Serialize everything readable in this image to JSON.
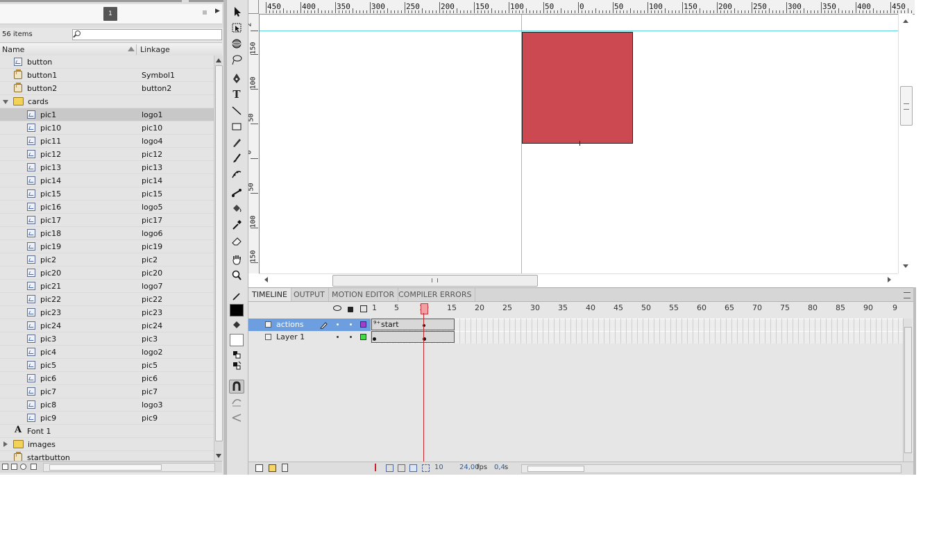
{
  "library": {
    "doc_tab_number": "1",
    "item_count": "56 items",
    "search_placeholder": "",
    "col_name": "Name",
    "col_linkage": "Linkage",
    "items": [
      {
        "name": "button",
        "linkage": "",
        "type": "bitmap",
        "indent": 1
      },
      {
        "name": "button1",
        "linkage": "Symbol1",
        "type": "button",
        "indent": 1
      },
      {
        "name": "button2",
        "linkage": "button2",
        "type": "button",
        "indent": 1
      },
      {
        "name": "cards",
        "linkage": "",
        "type": "folder-open",
        "indent": 0
      },
      {
        "name": "pic1",
        "linkage": "logo1",
        "type": "bitmap",
        "indent": 2,
        "selected": true
      },
      {
        "name": "pic10",
        "linkage": "pic10",
        "type": "bitmap",
        "indent": 2
      },
      {
        "name": "pic11",
        "linkage": "logo4",
        "type": "bitmap",
        "indent": 2
      },
      {
        "name": "pic12",
        "linkage": "pic12",
        "type": "bitmap",
        "indent": 2
      },
      {
        "name": "pic13",
        "linkage": "pic13",
        "type": "bitmap",
        "indent": 2
      },
      {
        "name": "pic14",
        "linkage": "pic14",
        "type": "bitmap",
        "indent": 2
      },
      {
        "name": "pic15",
        "linkage": "pic15",
        "type": "bitmap",
        "indent": 2
      },
      {
        "name": "pic16",
        "linkage": "logo5",
        "type": "bitmap",
        "indent": 2
      },
      {
        "name": "pic17",
        "linkage": "pic17",
        "type": "bitmap",
        "indent": 2
      },
      {
        "name": "pic18",
        "linkage": "logo6",
        "type": "bitmap",
        "indent": 2
      },
      {
        "name": "pic19",
        "linkage": "pic19",
        "type": "bitmap",
        "indent": 2
      },
      {
        "name": "pic2",
        "linkage": "pic2",
        "type": "bitmap",
        "indent": 2
      },
      {
        "name": "pic20",
        "linkage": "pic20",
        "type": "bitmap",
        "indent": 2
      },
      {
        "name": "pic21",
        "linkage": "logo7",
        "type": "bitmap",
        "indent": 2
      },
      {
        "name": "pic22",
        "linkage": "pic22",
        "type": "bitmap",
        "indent": 2
      },
      {
        "name": "pic23",
        "linkage": "pic23",
        "type": "bitmap",
        "indent": 2
      },
      {
        "name": "pic24",
        "linkage": "pic24",
        "type": "bitmap",
        "indent": 2
      },
      {
        "name": "pic3",
        "linkage": "pic3",
        "type": "bitmap",
        "indent": 2
      },
      {
        "name": "pic4",
        "linkage": "logo2",
        "type": "bitmap",
        "indent": 2
      },
      {
        "name": "pic5",
        "linkage": "pic5",
        "type": "bitmap",
        "indent": 2
      },
      {
        "name": "pic6",
        "linkage": "pic6",
        "type": "bitmap",
        "indent": 2
      },
      {
        "name": "pic7",
        "linkage": "pic7",
        "type": "bitmap",
        "indent": 2
      },
      {
        "name": "pic8",
        "linkage": "logo3",
        "type": "bitmap",
        "indent": 2
      },
      {
        "name": "pic9",
        "linkage": "pic9",
        "type": "bitmap",
        "indent": 2
      },
      {
        "name": "Font 1",
        "linkage": "",
        "type": "font",
        "indent": 1
      },
      {
        "name": "images",
        "linkage": "",
        "type": "folder-closed",
        "indent": 0
      },
      {
        "name": "startbutton",
        "linkage": "",
        "type": "button",
        "indent": 1
      }
    ]
  },
  "stage": {
    "ruler_h_labels": [
      "450",
      "400",
      "350",
      "300",
      "250",
      "200",
      "150",
      "100",
      "50",
      "0",
      "50",
      "100",
      "150",
      "200",
      "250",
      "300",
      "350",
      "400",
      "450"
    ],
    "ruler_v_labels": [
      "2",
      "150",
      "100",
      "50",
      "0",
      "50",
      "100",
      "150"
    ],
    "rect_color": "#cc4952",
    "guide_color": "#58d7e0"
  },
  "timeline": {
    "tabs": [
      "TIMELINE",
      "OUTPUT",
      "MOTION EDITOR",
      "COMPILER ERRORS"
    ],
    "frame_numbers": [
      "1",
      "5",
      "10",
      "15",
      "20",
      "25",
      "30",
      "35",
      "40",
      "45",
      "50",
      "55",
      "60",
      "65",
      "70",
      "75",
      "80",
      "85",
      "90",
      "9"
    ],
    "layers": [
      {
        "name": "actions",
        "color": "#a040c8",
        "selected": true
      },
      {
        "name": "Layer 1",
        "color": "#46d846",
        "selected": false
      }
    ],
    "frame_label": "start",
    "current_frame": "10",
    "fps": "24,00",
    "fps_unit": "fps",
    "elapsed": "0,4",
    "elapsed_unit": "s"
  }
}
